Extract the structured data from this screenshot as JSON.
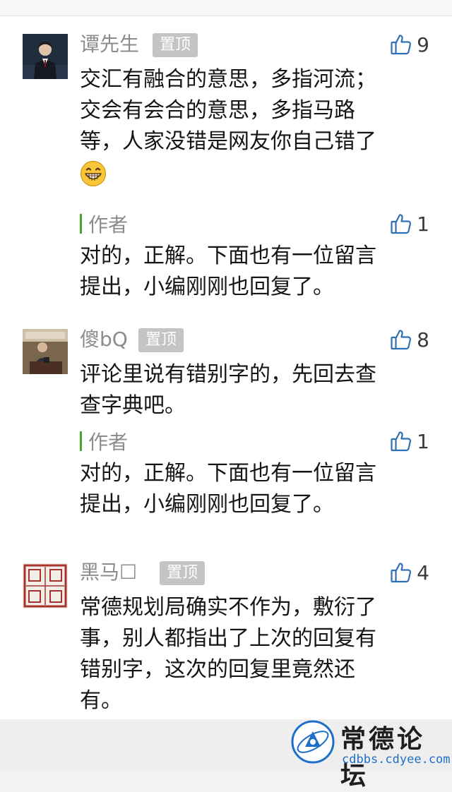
{
  "comments": [
    {
      "username": "谭先生",
      "pinned_label": "置顶",
      "likes": "9",
      "lines": [
        "交汇有融合的意思，多指河流；",
        "交会有会合的意思，多指马路",
        "等，人家没错是网友你自己错了"
      ],
      "emoji": "grinning-face-emoji",
      "reply": {
        "author_label": "作者",
        "likes": "1",
        "lines": [
          "对的，正解。下面也有一位留言",
          "提出，小编刚刚也回复了。"
        ]
      }
    },
    {
      "username": "傻bQ",
      "pinned_label": "置顶",
      "likes": "8",
      "lines": [
        "评论里说有错别字的，先回去查",
        "查字典吧。"
      ],
      "reply": {
        "author_label": "作者",
        "likes": "1",
        "lines": [
          "对的，正解。下面也有一位留言",
          "提出，小编刚刚也回复了。"
        ]
      }
    },
    {
      "username": "黑马☐",
      "pinned_label": "置顶",
      "likes": "4",
      "lines": [
        "常德规划局确实不作为，敷衍了",
        "事，别人都指出了上次的回复有",
        "错别字，这次的回复里竟然还",
        "有。"
      ]
    }
  ],
  "watermark": {
    "title": "常德论坛",
    "url": "cdbbs.cdyee.com"
  },
  "colors": {
    "background": "#ffffff",
    "author_bar": "#4ba72a",
    "pin_badge": "#c4c4c4",
    "like_icon": "#2f6fb5"
  }
}
